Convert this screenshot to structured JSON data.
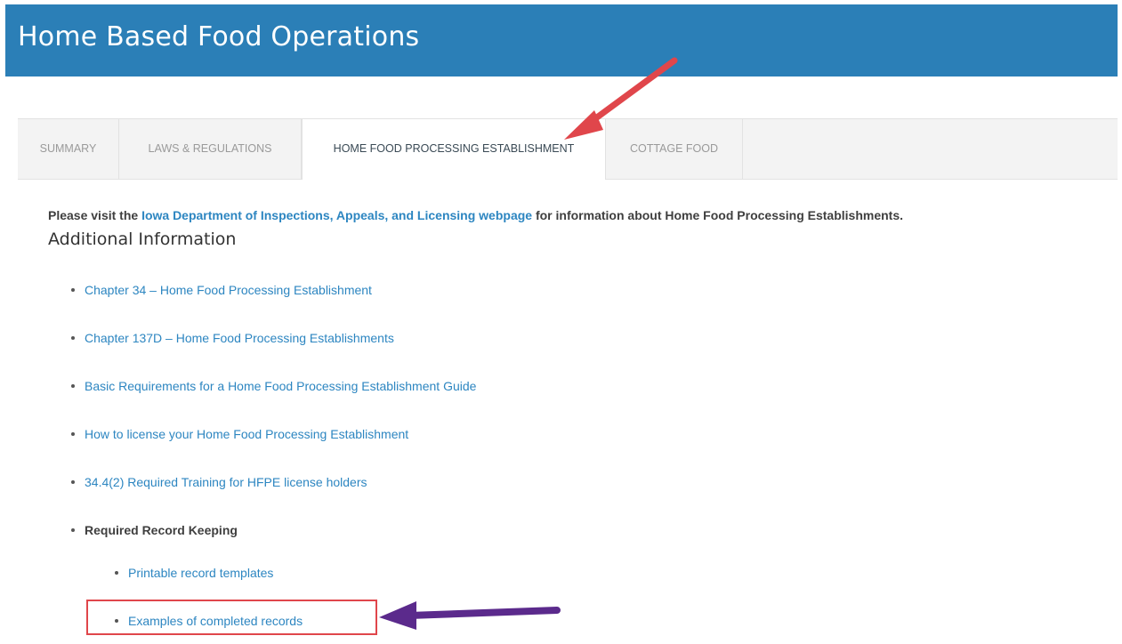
{
  "header": {
    "title": "Home Based Food Operations"
  },
  "tabs": [
    {
      "label": "SUMMARY",
      "active": false
    },
    {
      "label": "LAWS & REGULATIONS",
      "active": false
    },
    {
      "label": "HOME FOOD PROCESSING ESTABLISHMENT",
      "active": true
    },
    {
      "label": "COTTAGE FOOD",
      "active": false
    }
  ],
  "intro": {
    "prefix": "Please visit the ",
    "link": "Iowa Department of Inspections, Appeals, and Licensing webpage",
    "suffix": " for information about Home Food Processing Establishments."
  },
  "section": {
    "heading": "Additional Information"
  },
  "links": [
    "Chapter 34 – Home Food Processing Establishment",
    "Chapter 137D – Home Food Processing Establishments",
    "Basic Requirements  for a Home Food Processing Establishment Guide",
    "How to license your Home Food Processing Establishment",
    "34.4(2) Required Training for HFPE license holders"
  ],
  "record_keeping": {
    "label": "Required Record Keeping",
    "sub_links": [
      "Printable record templates",
      "Examples of completed records"
    ]
  },
  "colors": {
    "banner": "#2b7fb7",
    "link": "#2d86c1",
    "annotation_red_arrow": "#e0464b",
    "annotation_purple_arrow": "#5b2a8c"
  }
}
